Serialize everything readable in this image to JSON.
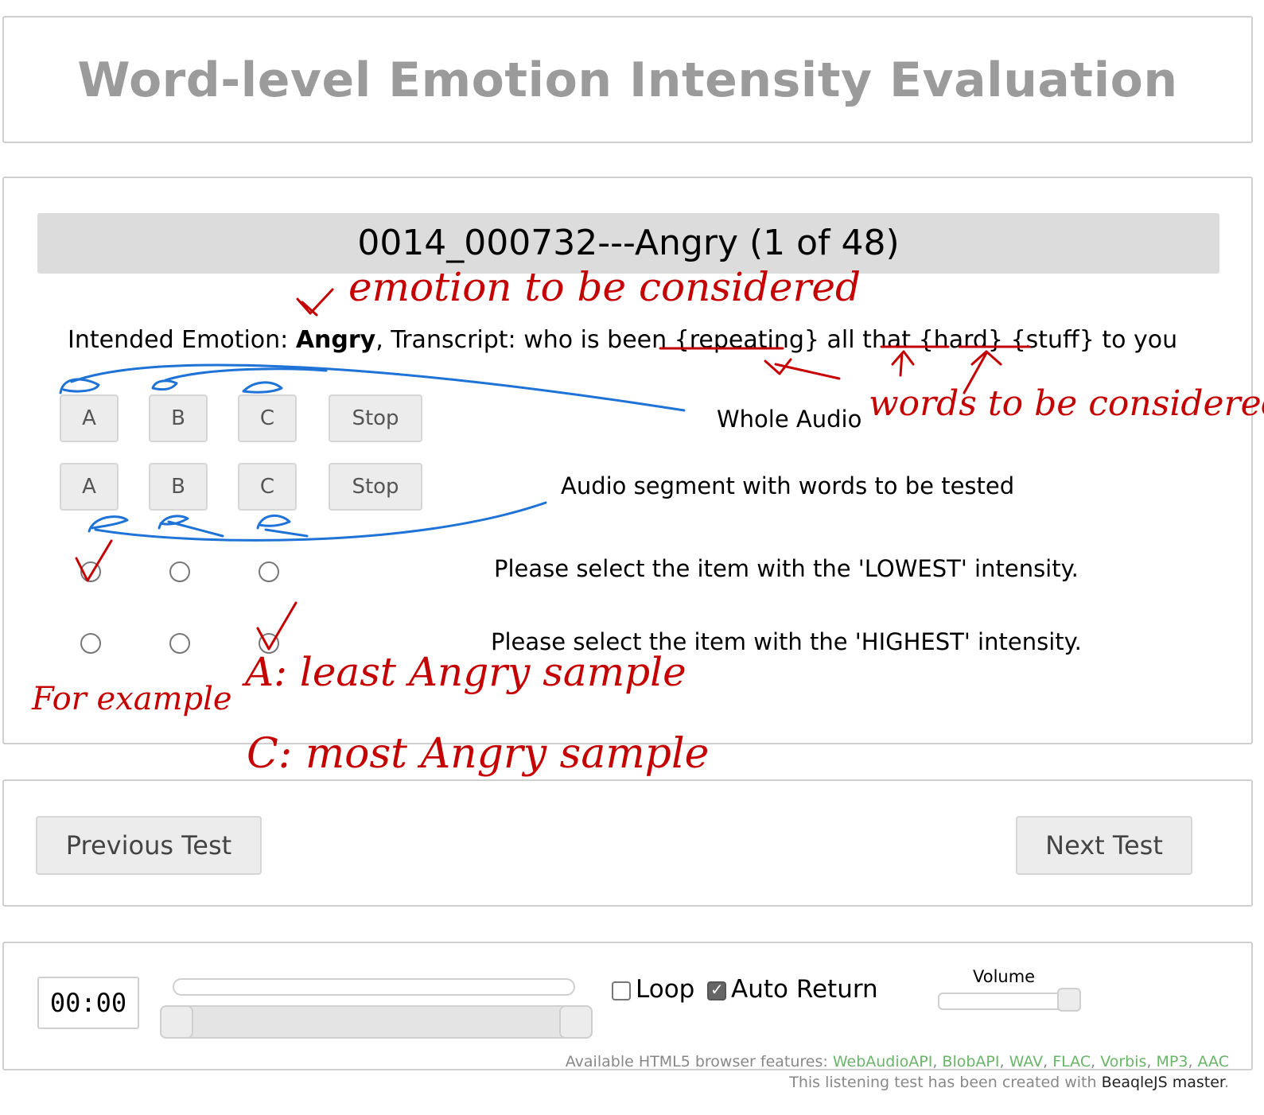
{
  "app": {
    "title": "Word-level Emotion Intensity Evaluation"
  },
  "test": {
    "header": "0014_000732---Angry (1 of 48)",
    "intended_label": "Intended Emotion: ",
    "emotion": "Angry",
    "transcript_label": ", Transcript: ",
    "transcript_pre": "who is been ",
    "word1": "{repeating}",
    "mid1": " all that ",
    "word2": "{hard}",
    "mid2": " ",
    "word3": "{stuff}",
    "post": " to you"
  },
  "rows": {
    "whole": {
      "buttons": [
        "A",
        "B",
        "C"
      ],
      "stop": "Stop",
      "label": "Whole Audio"
    },
    "segment": {
      "buttons": [
        "A",
        "B",
        "C"
      ],
      "stop": "Stop",
      "label": "Audio segment with words to be tested"
    },
    "lowest": {
      "label": "Please select the item with the 'LOWEST' intensity."
    },
    "highest": {
      "label": "Please select the item with the 'HIGHEST' intensity."
    }
  },
  "nav": {
    "previous": "Previous Test",
    "next": "Next Test"
  },
  "player": {
    "time": "00:00",
    "loop_label": "Loop",
    "loop_checked": false,
    "auto_return_label": "Auto Return",
    "auto_return_checked": true,
    "volume_label": "Volume",
    "volume_level": 0.95
  },
  "footer": {
    "features_label": "Available HTML5 browser features: ",
    "features": [
      "WebAudioAPI",
      "BlobAPI",
      "WAV",
      "FLAC",
      "Vorbis",
      "MP3",
      "AAC"
    ],
    "created_label": "This listening test has been created with ",
    "created_by": "BeaqleJS master",
    "created_end": "."
  },
  "annotations": {
    "emotion_note": "emotion to be considered",
    "words_note": "words to be considered",
    "example": "For example",
    "a_note": "A: least Angry sample",
    "c_note": "C: most Angry sample",
    "check_mark": "✓"
  },
  "colors": {
    "title_gray": "#9b9b9b",
    "annotation_red": "#c40000",
    "annotation_blue": "#1f73d6",
    "feature_green": "#6bb56b"
  }
}
